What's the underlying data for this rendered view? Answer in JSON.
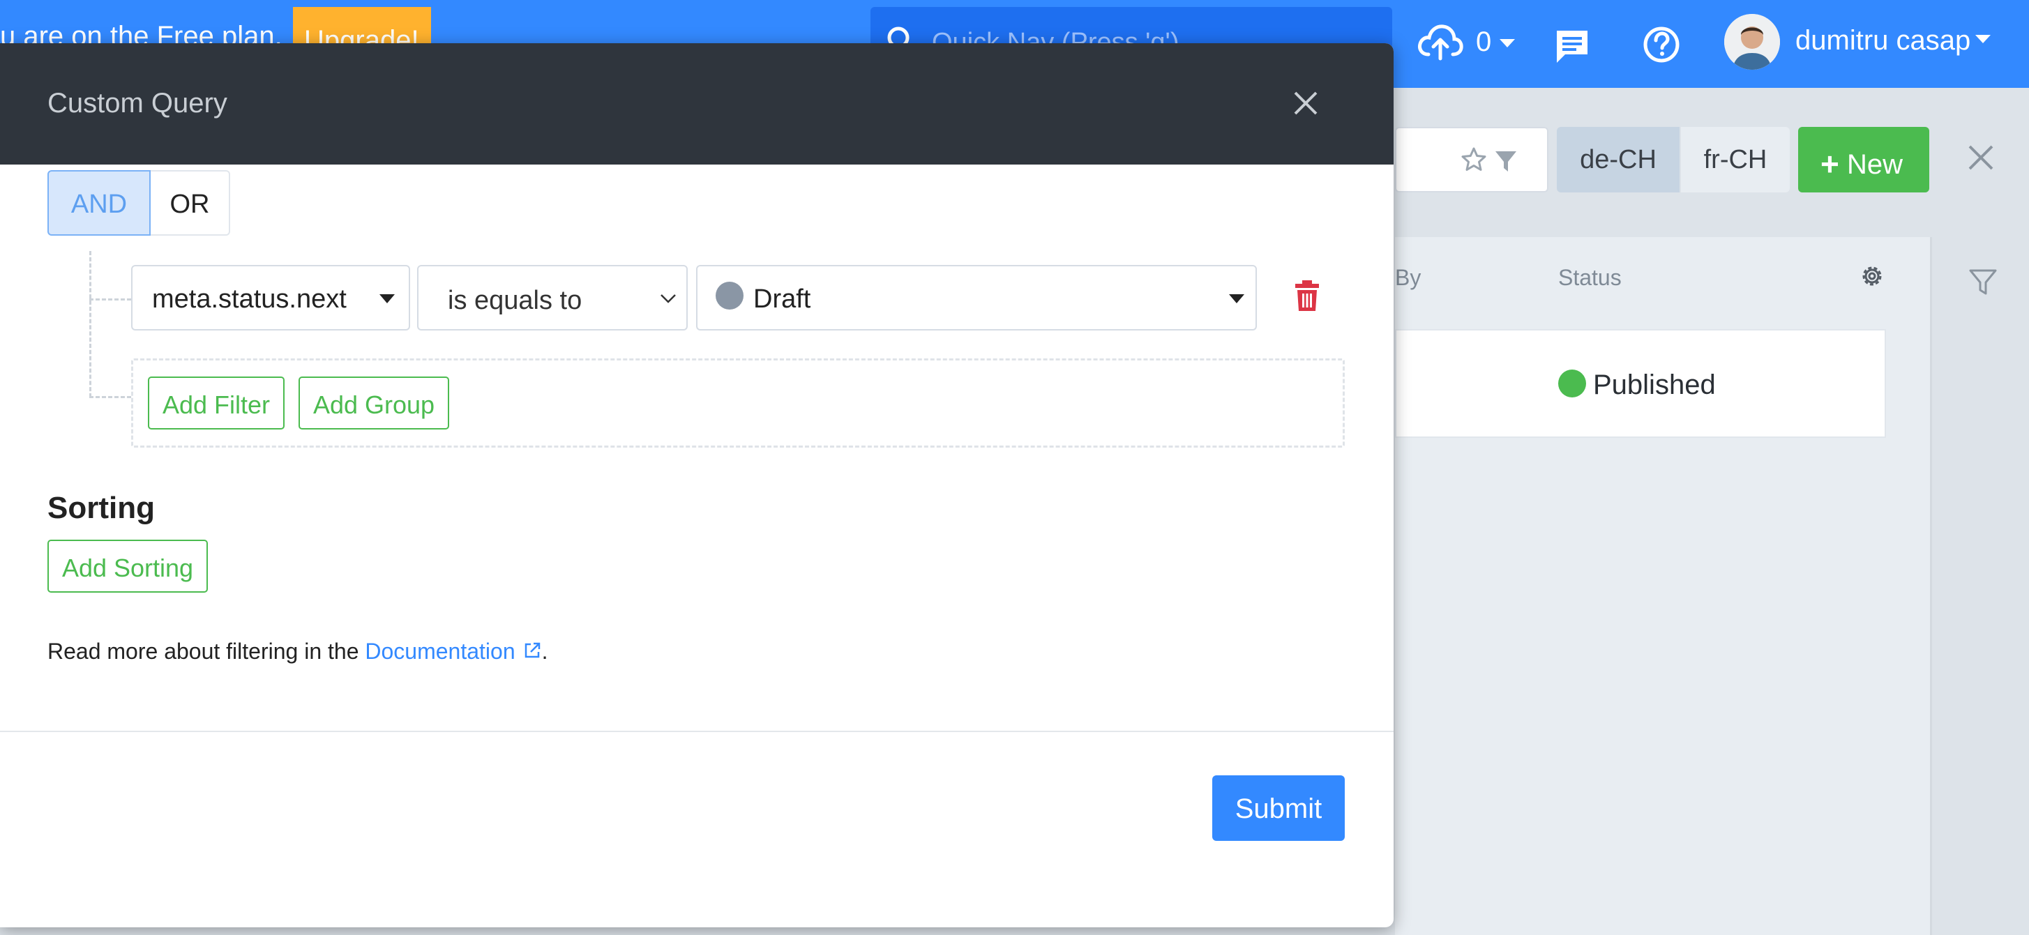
{
  "topbar": {
    "plan_text": "u are on the Free plan.",
    "upgrade_label": "Upgrade!",
    "quicknav_placeholder": "Quick Nav (Press 'q')",
    "upload_count": "0",
    "user_name": "dumitru casap",
    "accent_color": "#3389ff"
  },
  "background": {
    "languages": [
      "de-CH",
      "fr-CH"
    ],
    "new_button_label": "New",
    "columns": {
      "by": "By",
      "status": "Status"
    },
    "rows": [
      {
        "status": "Published",
        "status_color": "#4bbb4f"
      }
    ]
  },
  "modal": {
    "title": "Custom Query",
    "logic": {
      "and_label": "AND",
      "or_label": "OR",
      "selected": "AND"
    },
    "filter": {
      "field": "meta.status.next",
      "operator": "is equals to",
      "value": "Draft",
      "value_color": "#8a96a5"
    },
    "add_filter_label": "Add Filter",
    "add_group_label": "Add Group",
    "sorting_title": "Sorting",
    "add_sorting_label": "Add Sorting",
    "docs_prefix": "Read more about filtering in the ",
    "docs_link_label": "Documentation",
    "docs_suffix": ".",
    "submit_label": "Submit"
  },
  "icons": [
    "search-icon",
    "cloud-upload-icon",
    "chat-icon",
    "help-icon",
    "star-icon",
    "filter-icon",
    "close-icon",
    "gear-icon",
    "trash-icon",
    "external-link-icon",
    "plus-icon"
  ]
}
